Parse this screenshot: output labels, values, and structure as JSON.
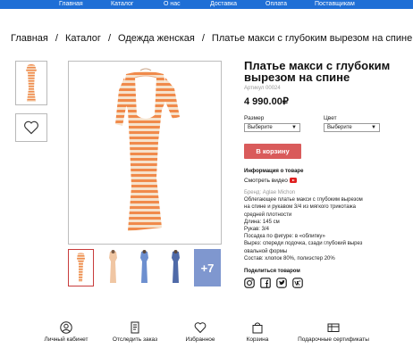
{
  "topnav": {
    "items": [
      "Главная",
      "Каталог",
      "О нас",
      "Доставка",
      "Оплата",
      "Поставщикам"
    ]
  },
  "breadcrumb": [
    "Главная",
    "Каталог",
    "Одежда женская",
    "Платье макси с глубоким вырезом на спине"
  ],
  "product": {
    "title": "Платье макси с глубоким вырезом на спине",
    "sku": "Артикул 00024",
    "price": "4 990.00₽",
    "size_label": "Размер",
    "size_value": "Выберите",
    "color_label": "Цвет",
    "color_value": "Выберите",
    "cart_label": "В корзину",
    "info_heading": "Информация о товаре",
    "video_link": "Смотреть видео",
    "brand": "Бренд: Aglae Michon",
    "description": [
      "Облегающее платье макси с глубоким вырезом",
      "на спине и рукавом 3/4 из мягкого трикотажа",
      "средней плотности",
      "Длина: 145 см",
      "Рукав: 3/4",
      "Посадка по фигуре: в «облипку»",
      "Вырез: спереди лодочка, сзади глубокий вырез",
      "овальной формы",
      "Состав: хлопок 80%, полиэстер 20%"
    ],
    "more_photos": "+7",
    "share_heading": "Поделиться товаром"
  },
  "bottom_nav": {
    "items": [
      "Личный кабинет",
      "Отследить заказ",
      "Избранное",
      "Корзина",
      "Подарочные сертификаты"
    ]
  },
  "colors": {
    "nav": "#1f6fd6",
    "cart_button": "#d95b5b",
    "stripe_orange": "#f08a4b",
    "stripe_cream": "#f6e2cc"
  }
}
